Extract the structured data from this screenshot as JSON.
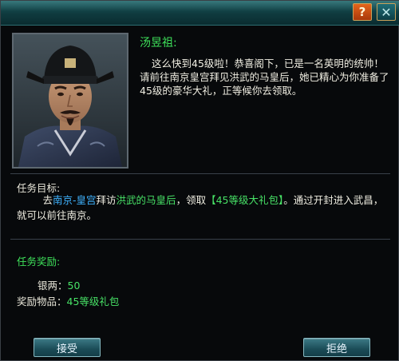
{
  "titlebar": {
    "help_label": "?",
    "close_label": "✕"
  },
  "npc": {
    "name": "汤昱祖:",
    "dialog": "这么快到45级啦！恭喜阁下，已是一名英明的统帅！请前往南京皇宫拜见洪武的马皇后，她已精心为你准备了45级的豪华大礼，正等候你去领取。"
  },
  "quest": {
    "goal_label": "任务目标:",
    "goal_prefix": "去",
    "goal_location": "南京-皇宫",
    "goal_verb": "拜访",
    "goal_npc": "洪武的马皇后",
    "goal_mid": "，领取",
    "goal_item": "【45等级大礼包】",
    "goal_suffix": "。通过开封进入武昌，就可以前往南京。",
    "reward_label": "任务奖励:",
    "rewards": [
      {
        "key": "银两：",
        "value": "50"
      },
      {
        "key": "奖励物品：",
        "value": "45等级礼包"
      }
    ]
  },
  "buttons": {
    "accept_label": "接受",
    "reject_label": "拒绝"
  },
  "colors": {
    "title_green": "#3ee05a",
    "location_blue": "#3fb3ff",
    "highlight_green": "#47e166",
    "titlebar_teal": "#1b5a5e"
  },
  "icons": {
    "help": "question-mark-icon",
    "close": "close-x-icon"
  }
}
